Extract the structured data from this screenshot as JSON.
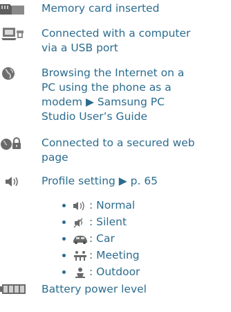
{
  "entries": [
    {
      "icon": "memory-card-icon",
      "text": "Memory card inserted"
    },
    {
      "icon": "usb-computer-icon",
      "lines": [
        "Connected with a computer",
        "via a USB port"
      ]
    },
    {
      "icon": "globe-icon",
      "lines": [
        "Browsing the Internet on a",
        "PC using the phone as a",
        "modem ▶ Samsung PC",
        "Studio User’s Guide"
      ]
    },
    {
      "icon": "secured-web-icon",
      "lines": [
        "Connected to a secured web",
        "page"
      ]
    },
    {
      "icon": "profile-speaker-icon",
      "text": "Profile setting ▶ p. 65"
    },
    {
      "icon": "battery-icon",
      "text": "Battery power level"
    }
  ],
  "profiles": [
    {
      "icon": "normal-speaker-icon",
      "label": ": Normal"
    },
    {
      "icon": "silent-icon",
      "label": " : Silent"
    },
    {
      "icon": "car-icon",
      "label": ": Car"
    },
    {
      "icon": "meeting-icon",
      "label": ": Meeting"
    },
    {
      "icon": "outdoor-icon",
      "label": " : Outdoor"
    }
  ],
  "colors": {
    "text": "#2b6c8e",
    "icon": "#707070"
  }
}
